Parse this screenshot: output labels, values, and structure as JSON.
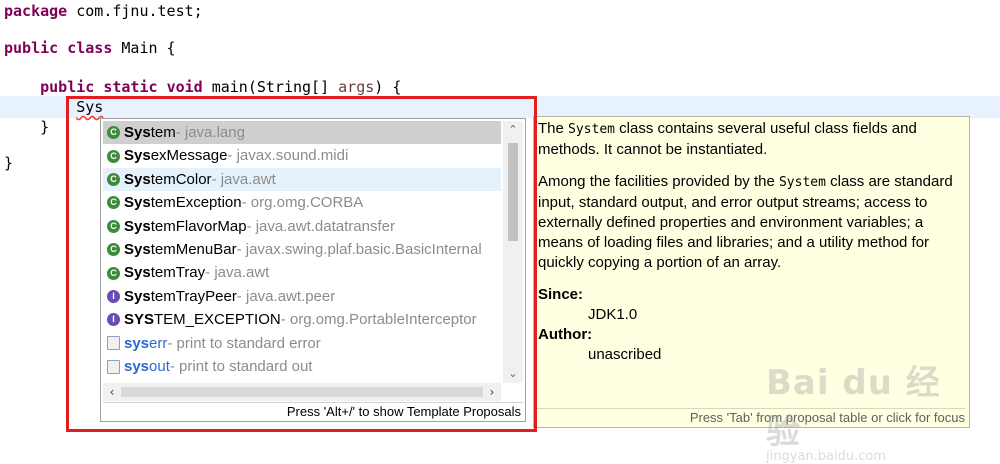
{
  "code": {
    "line1_kw": "package",
    "line1_rest": " com.fjnu.test;",
    "line3_kw1": "public",
    "line3_kw2": "class",
    "line3_rest": " Main {",
    "line5_indent": "    ",
    "line5_kw1": "public",
    "line5_kw2": "static",
    "line5_kw3": "void",
    "line5_rest": " main(String[] ",
    "line5_param": "args",
    "line5_end": ") {",
    "line6_indent": "        ",
    "line6_typed": "Sys",
    "line7": "    }",
    "line9": "}"
  },
  "proposals": [
    {
      "icon": "class",
      "match": "Sys",
      "rest": "tem",
      "pkg": " - java.lang",
      "state": "selected"
    },
    {
      "icon": "class",
      "match": "Sys",
      "rest": "exMessage",
      "pkg": " - javax.sound.midi",
      "state": ""
    },
    {
      "icon": "class",
      "match": "Sys",
      "rest": "temColor",
      "pkg": " - java.awt",
      "state": "hover"
    },
    {
      "icon": "class",
      "match": "Sys",
      "rest": "temException",
      "pkg": " - org.omg.CORBA",
      "state": ""
    },
    {
      "icon": "class",
      "match": "Sys",
      "rest": "temFlavorMap",
      "pkg": " - java.awt.datatransfer",
      "state": ""
    },
    {
      "icon": "class",
      "match": "Sys",
      "rest": "temMenuBar",
      "pkg": " - javax.swing.plaf.basic.BasicInternal",
      "state": ""
    },
    {
      "icon": "class",
      "match": "Sys",
      "rest": "temTray",
      "pkg": " - java.awt",
      "state": ""
    },
    {
      "icon": "interface",
      "match": "Sys",
      "rest": "temTrayPeer",
      "pkg": " - java.awt.peer",
      "state": ""
    },
    {
      "icon": "interface",
      "match": "SYS",
      "rest": "TEM_EXCEPTION",
      "pkg": " - org.omg.PortableInterceptor",
      "state": ""
    },
    {
      "icon": "template",
      "match": "sys",
      "rest": "err",
      "pkg": " - print to standard error",
      "state": ""
    },
    {
      "icon": "template",
      "match": "sys",
      "rest": "out",
      "pkg": " - print to standard out",
      "state": ""
    }
  ],
  "popup_status": "Press 'Alt+/' to show Template Proposals",
  "doc": {
    "p1_pre": "The ",
    "p1_code": "System",
    "p1_post": " class contains several useful class fields and methods. It cannot be instantiated.",
    "p2_pre": "Among the facilities provided by the ",
    "p2_code": "System",
    "p2_post": " class are standard input, standard output, and error output streams; access to externally defined properties and environment variables; a means of loading files and libraries; and a utility method for quickly copying a portion of an array.",
    "since_label": "Since:",
    "since_value": "JDK1.0",
    "author_label": "Author:",
    "author_value": "unascribed",
    "status": "Press 'Tab' from proposal table or click for focus"
  },
  "watermark": {
    "main": "Bai du 经验",
    "sub": "jingyan.baidu.com"
  }
}
